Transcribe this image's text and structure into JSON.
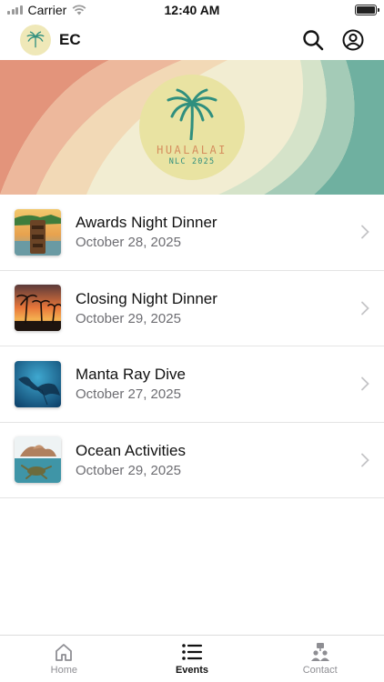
{
  "status_bar": {
    "carrier": "Carrier",
    "time": "12:40 AM"
  },
  "header": {
    "brand": "EC",
    "logo_icon": "palm-tree-icon"
  },
  "hero": {
    "line1": "HUALALAI",
    "line2": "NLC 2025"
  },
  "events": [
    {
      "title": "Awards Night Dinner",
      "date": "October 28, 2025"
    },
    {
      "title": "Closing Night Dinner",
      "date": "October 29, 2025"
    },
    {
      "title": "Manta Ray Dive",
      "date": "October 27, 2025"
    },
    {
      "title": "Ocean Activities",
      "date": "October 29, 2025"
    }
  ],
  "tabs": [
    {
      "label": "Home",
      "icon": "home-icon",
      "active": false
    },
    {
      "label": "Events",
      "icon": "list-icon",
      "active": true
    },
    {
      "label": "Contact",
      "icon": "contact-icon",
      "active": false
    }
  ],
  "colors": {
    "hero_coral": "#e3947b",
    "hero_cream": "#f2edd2",
    "hero_teal": "#6fb0a0",
    "logo_circle": "#e9e3a2",
    "palm_green": "#2f8f7e",
    "date_gray": "#6d6d72"
  }
}
